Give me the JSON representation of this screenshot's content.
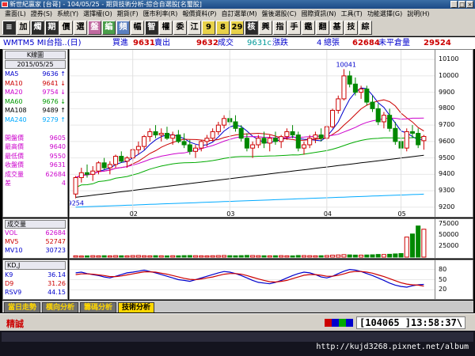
{
  "window": {
    "title": "新世紀贏家 [台哥] - 104/05/25 - 期貨技術分析-綜合自選股[名璽股]"
  },
  "menu": [
    "畫面(L)",
    "證券(S)",
    "系統(Y)",
    "選擇權(O)",
    "期貨(F)",
    "匯市利率(R)",
    "報價資料(P)",
    "自訂選單(M)",
    "盤後選股(C)",
    "國際資訊(N)",
    "工具(T)",
    "功能選擇(G)",
    "說明(H)"
  ],
  "toolbar": [
    "≡",
    "加",
    "燭",
    "期",
    "價",
    "選",
    "盤",
    "編",
    "頻",
    "幅",
    "智",
    "權",
    "委",
    "江",
    "9",
    "8",
    "29",
    "核",
    "興",
    "指",
    "手",
    "鑑",
    "翻",
    "基",
    "技",
    "綜"
  ],
  "header": {
    "symbol": "WMTM5 MI台指..(日)",
    "bid_label": "買進",
    "bid_value": "9631",
    "ask_value": "9632",
    "ask_label": "賣出",
    "last_value": "9631",
    "last_label": "成交",
    "change_value": "9631c",
    "change_label": "漲跌",
    "ticks_value": "4",
    "ticks_label": "總張",
    "volume_value": "62684",
    "volume_label": "未平倉量",
    "oi_value": "29524"
  },
  "left_panel": {
    "title": "K線圖",
    "date": "2015/05/25",
    "rows": [
      {
        "label": "MA5",
        "value": "9636 ↑",
        "color": "#0000cc"
      },
      {
        "label": "MA10",
        "value": "9641 ↓",
        "color": "#cc0000"
      },
      {
        "label": "MA20",
        "value": "9754 ↓",
        "color": "#cc00cc"
      },
      {
        "label": "MA60",
        "value": "9676 ↓",
        "color": "#009900"
      },
      {
        "label": "MA108",
        "value": "9489 ↑",
        "color": "#000000"
      },
      {
        "label": "MA240",
        "value": "9279 ↑",
        "color": "#00aaff"
      },
      {
        "label": "",
        "value": "",
        "color": "#000"
      },
      {
        "label": "開盤價",
        "value": "9605",
        "color": "#cc00cc"
      },
      {
        "label": "最高價",
        "value": "9640",
        "color": "#cc00cc"
      },
      {
        "label": "最低價",
        "value": "9550",
        "color": "#cc00cc"
      },
      {
        "label": "收盤價",
        "value": "9631",
        "color": "#cc00cc"
      },
      {
        "label": "成交量",
        "value": "62684",
        "color": "#cc00cc"
      },
      {
        "label": "差",
        "value": "4",
        "color": "#cc00cc"
      }
    ]
  },
  "price_axis": [
    "10100",
    "10000",
    "9900",
    "9800",
    "9700",
    "9600",
    "9500",
    "9400",
    "9300",
    "9200"
  ],
  "volume_panel": {
    "title": "成交量",
    "rows": [
      {
        "label": "VOL",
        "value": "62684",
        "color": "#cc00cc"
      },
      {
        "label": "MV5",
        "value": "52747",
        "color": "#cc0000"
      },
      {
        "label": "MV10",
        "value": "30723",
        "color": "#0000cc"
      }
    ],
    "axis": [
      "75000",
      "50000",
      "25000"
    ]
  },
  "kd_panel": {
    "title": "KD,J",
    "rows": [
      {
        "label": "K9",
        "value": "36.14",
        "color": "#0000cc"
      },
      {
        "label": "D9",
        "value": "31.26",
        "color": "#cc0000"
      },
      {
        "label": "RSV9",
        "value": "44.15",
        "color": "#0000cc"
      }
    ],
    "axis": [
      "80",
      "50",
      "20"
    ]
  },
  "tabs": [
    "當日走勢",
    "橫向分析",
    "籌碼分析",
    "技術分析"
  ],
  "active_tab": 3,
  "status": {
    "name": "精誠",
    "info": "[104065 ]13:58:37\\"
  },
  "watermark": "http://kujd3268.pixnet.net/album",
  "chart_data": {
    "type": "candlestick",
    "x_ticks": [
      "02",
      "03",
      "04",
      "05"
    ],
    "ylim": [
      9180,
      10120
    ],
    "annotations": [
      {
        "label": "10041",
        "value": 10041
      },
      {
        "label": "9254",
        "value": 9254
      }
    ],
    "candles": [
      [
        9280,
        9390,
        9254,
        9380
      ],
      [
        9380,
        9440,
        9350,
        9410
      ],
      [
        9410,
        9460,
        9380,
        9400
      ],
      [
        9400,
        9450,
        9360,
        9420
      ],
      [
        9420,
        9480,
        9400,
        9470
      ],
      [
        9470,
        9500,
        9430,
        9440
      ],
      [
        9440,
        9480,
        9400,
        9460
      ],
      [
        9460,
        9520,
        9440,
        9510
      ],
      [
        9510,
        9540,
        9470,
        9480
      ],
      [
        9480,
        9510,
        9440,
        9500
      ],
      [
        9500,
        9560,
        9480,
        9550
      ],
      [
        9550,
        9600,
        9520,
        9570
      ],
      [
        9570,
        9640,
        9550,
        9630
      ],
      [
        9630,
        9680,
        9600,
        9660
      ],
      [
        9660,
        9700,
        9620,
        9640
      ],
      [
        9640,
        9680,
        9600,
        9650
      ],
      [
        9650,
        9690,
        9610,
        9620
      ],
      [
        9620,
        9660,
        9580,
        9640
      ],
      [
        9640,
        9670,
        9590,
        9600
      ],
      [
        9600,
        9650,
        9560,
        9580
      ],
      [
        9580,
        9610,
        9520,
        9540
      ],
      [
        9540,
        9580,
        9500,
        9560
      ],
      [
        9560,
        9610,
        9540,
        9600
      ],
      [
        9600,
        9640,
        9570,
        9620
      ],
      [
        9620,
        9680,
        9600,
        9660
      ],
      [
        9660,
        9720,
        9640,
        9700
      ],
      [
        9700,
        9760,
        9680,
        9740
      ],
      [
        9740,
        9790,
        9700,
        9720
      ],
      [
        9720,
        9760,
        9660,
        9680
      ],
      [
        9680,
        9700,
        9600,
        9620
      ],
      [
        9620,
        9650,
        9540,
        9560
      ],
      [
        9560,
        9600,
        9500,
        9580
      ],
      [
        9580,
        9640,
        9560,
        9620
      ],
      [
        9620,
        9660,
        9560,
        9590
      ],
      [
        9590,
        9640,
        9540,
        9620
      ],
      [
        9620,
        9660,
        9580,
        9600
      ],
      [
        9600,
        9640,
        9560,
        9630
      ],
      [
        9630,
        9680,
        9610,
        9660
      ],
      [
        9660,
        9700,
        9620,
        9640
      ],
      [
        9640,
        9660,
        9540,
        9560
      ],
      [
        9560,
        9600,
        9520,
        9580
      ],
      [
        9580,
        9640,
        9560,
        9620
      ],
      [
        9620,
        9660,
        9590,
        9640
      ],
      [
        9640,
        9680,
        9600,
        9620
      ],
      [
        9620,
        9700,
        9610,
        9690
      ],
      [
        9690,
        9800,
        9680,
        9790
      ],
      [
        9790,
        9880,
        9770,
        9860
      ],
      [
        9860,
        10041,
        9850,
        10000
      ],
      [
        10000,
        10030,
        9930,
        9950
      ],
      [
        9950,
        9990,
        9880,
        9900
      ],
      [
        9900,
        9940,
        9860,
        9920
      ],
      [
        9920,
        9940,
        9820,
        9840
      ],
      [
        9840,
        9880,
        9780,
        9800
      ],
      [
        9800,
        9830,
        9700,
        9720
      ],
      [
        9720,
        9780,
        9680,
        9760
      ],
      [
        9760,
        9800,
        9660,
        9680
      ],
      [
        9680,
        9720,
        9580,
        9600
      ],
      [
        9600,
        9640,
        9520,
        9560
      ],
      [
        9560,
        9680,
        9540,
        9660
      ],
      [
        9660,
        9700,
        9620,
        9650
      ],
      [
        9650,
        9680,
        9560,
        9580
      ],
      [
        9605,
        9640,
        9550,
        9631
      ]
    ],
    "volume": [
      3000,
      2500,
      2800,
      3200,
      2900,
      3100,
      2700,
      3300,
      3000,
      2800,
      3400,
      3600,
      3100,
      2900,
      3200,
      3000,
      2800,
      3100,
      2900,
      3300,
      3500,
      3200,
      3000,
      2800,
      3100,
      3400,
      3600,
      3200,
      3000,
      3300,
      3800,
      3500,
      3200,
      3000,
      2900,
      3100,
      3300,
      3000,
      2800,
      3600,
      3400,
      3200,
      3000,
      3100,
      3500,
      4200,
      4800,
      5500,
      5000,
      4600,
      4400,
      4800,
      5200,
      6000,
      5800,
      6400,
      7200,
      8000,
      45000,
      52000,
      70000,
      62684
    ],
    "k9": [
      70,
      72,
      68,
      65,
      62,
      58,
      55,
      60,
      65,
      70,
      72,
      75,
      78,
      74,
      70,
      65,
      60,
      55,
      50,
      48,
      45,
      50,
      55,
      60,
      65,
      70,
      74,
      72,
      68,
      62,
      55,
      48,
      42,
      40,
      38,
      42,
      48,
      55,
      62,
      68,
      72,
      70,
      65,
      58,
      55,
      60,
      68,
      75,
      80,
      78,
      74,
      68,
      62,
      55,
      48,
      40,
      34,
      30,
      28,
      32,
      35,
      36
    ],
    "d9": [
      65,
      67,
      67,
      66,
      64,
      62,
      59,
      59,
      61,
      64,
      67,
      70,
      73,
      73,
      72,
      69,
      66,
      62,
      58,
      54,
      51,
      50,
      52,
      55,
      58,
      62,
      66,
      68,
      68,
      66,
      62,
      57,
      52,
      48,
      44,
      43,
      45,
      48,
      53,
      58,
      63,
      65,
      65,
      63,
      60,
      60,
      63,
      67,
      72,
      74,
      74,
      72,
      69,
      64,
      59,
      53,
      47,
      41,
      37,
      35,
      34,
      31
    ]
  }
}
